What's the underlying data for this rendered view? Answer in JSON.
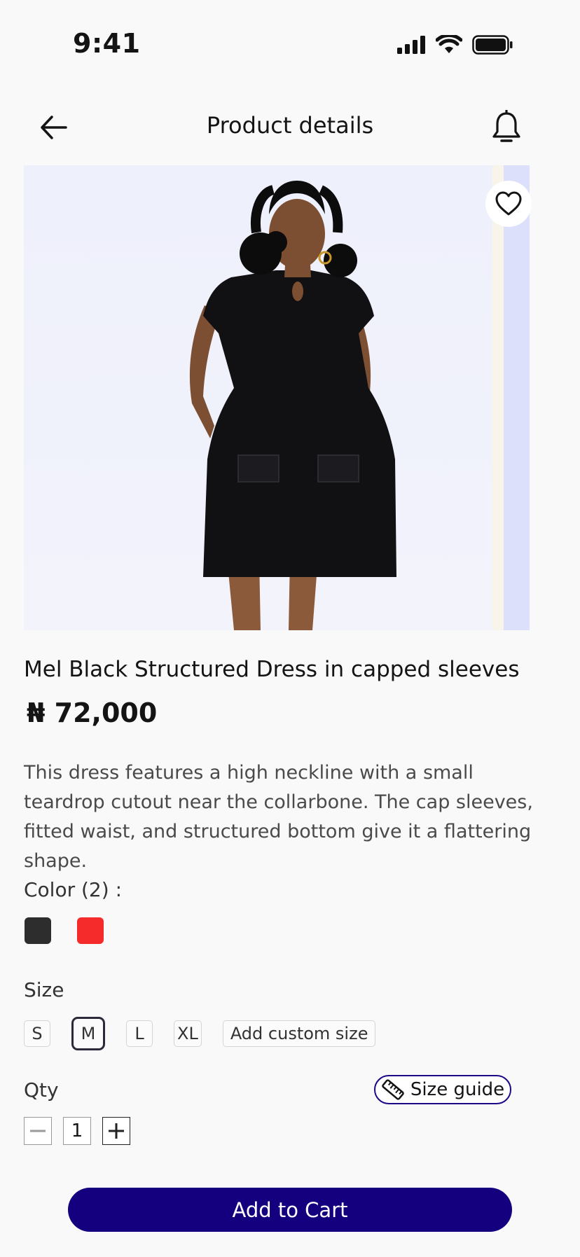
{
  "status_bar": {
    "time": "9:41"
  },
  "header": {
    "title": "Product details"
  },
  "product": {
    "name": "Mel Black Structured Dress in capped sleeves",
    "price": "₦ 72,000",
    "description": "This dress features a high neckline with a small teardrop cutout near the collarbone. The cap sleeves, fitted waist, and structured bottom give it a flattering shape."
  },
  "color": {
    "label": "Color (2)  :",
    "swatches": [
      "#2d2d2d",
      "#f52a2a"
    ]
  },
  "size": {
    "label": "Size",
    "options": [
      "S",
      "M",
      "L",
      "XL"
    ],
    "selected": "M",
    "custom_label": "Add custom size"
  },
  "qty": {
    "label": "Qty",
    "value": "1",
    "size_guide_label": "Size guide"
  },
  "cart": {
    "button_label": "Add to Cart"
  },
  "colors": {
    "accent": "#14007f",
    "background": "#f9f9fa"
  }
}
